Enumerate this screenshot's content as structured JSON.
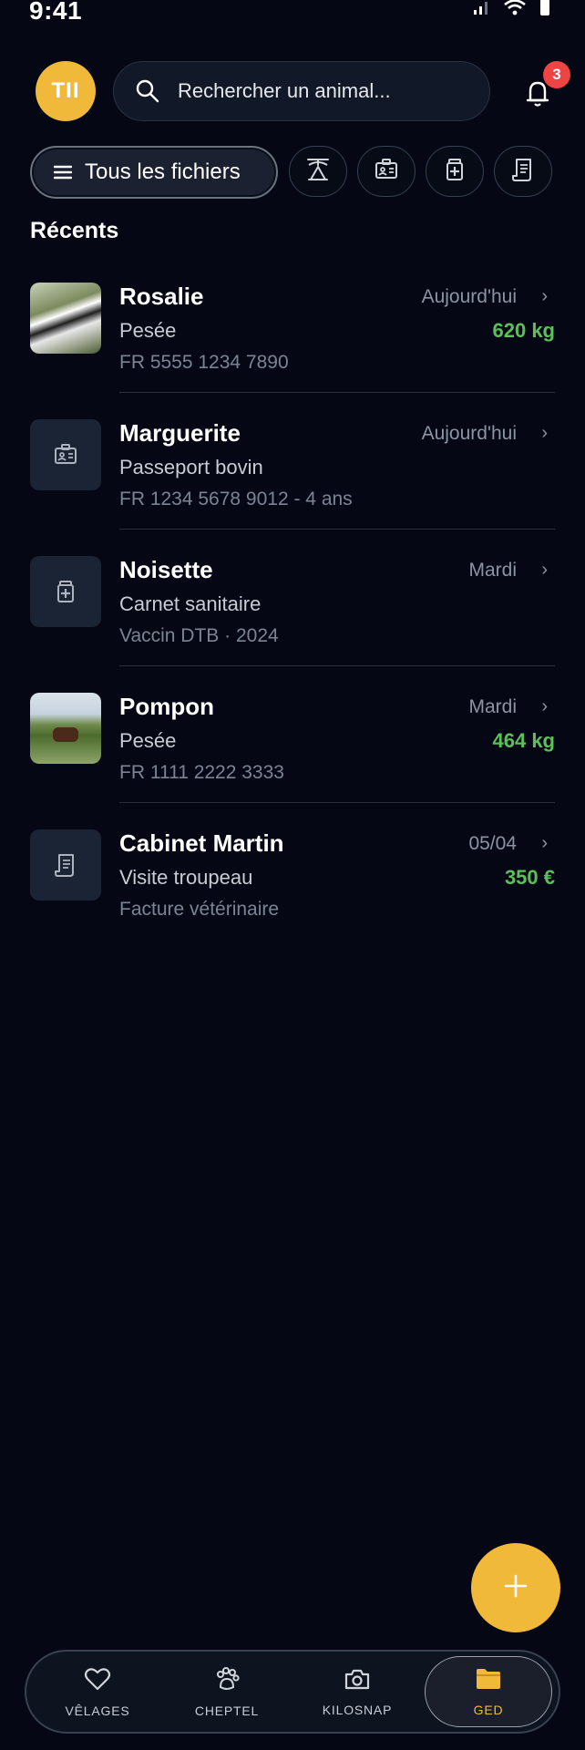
{
  "status_bar": {
    "time": "9:41"
  },
  "header": {
    "avatar_initials": "TII",
    "search_placeholder": "Rechercher un animal...",
    "notification_count": "3"
  },
  "filters": {
    "main_label": "Tous les fichiers",
    "chips": [
      "weigh-scale-icon",
      "id-card-icon",
      "medicine-icon",
      "invoice-icon"
    ]
  },
  "section": {
    "title": "Récents"
  },
  "items": [
    {
      "title": "Rosalie",
      "subtitle": "Pesée",
      "meta": "FR 5555 1234 7890",
      "date": "Aujourd'hui",
      "value": "620 kg",
      "thumb": "photo"
    },
    {
      "title": "Marguerite",
      "subtitle": "Passeport bovin",
      "meta": "FR 1234 5678 9012 - 4 ans",
      "date": "Aujourd'hui",
      "value": "",
      "thumb": "id-card-icon"
    },
    {
      "title": "Noisette",
      "subtitle": "Carnet sanitaire",
      "meta": "Vaccin DTB · 2024",
      "date": "Mardi",
      "value": "",
      "thumb": "medicine-icon"
    },
    {
      "title": "Pompon",
      "subtitle": "Pesée",
      "meta": "FR 1111 2222 3333",
      "date": "Mardi",
      "value": "464 kg",
      "thumb": "photo"
    },
    {
      "title": "Cabinet Martin",
      "subtitle": "Visite troupeau",
      "meta": "Facture vétérinaire",
      "date": "05/04",
      "value": "350 €",
      "thumb": "invoice-icon"
    }
  ],
  "bottom_nav": [
    {
      "label": "VÊLAGES",
      "icon": "heart-icon"
    },
    {
      "label": "CHEPTEL",
      "icon": "paw-icon"
    },
    {
      "label": "KILOSNAP",
      "icon": "camera-icon"
    },
    {
      "label": "GED",
      "icon": "folder-icon",
      "active": true
    }
  ],
  "colors": {
    "accent": "#f0b93a",
    "positive": "#5cbf5a",
    "badge": "#ef4444",
    "background": "#050814"
  }
}
